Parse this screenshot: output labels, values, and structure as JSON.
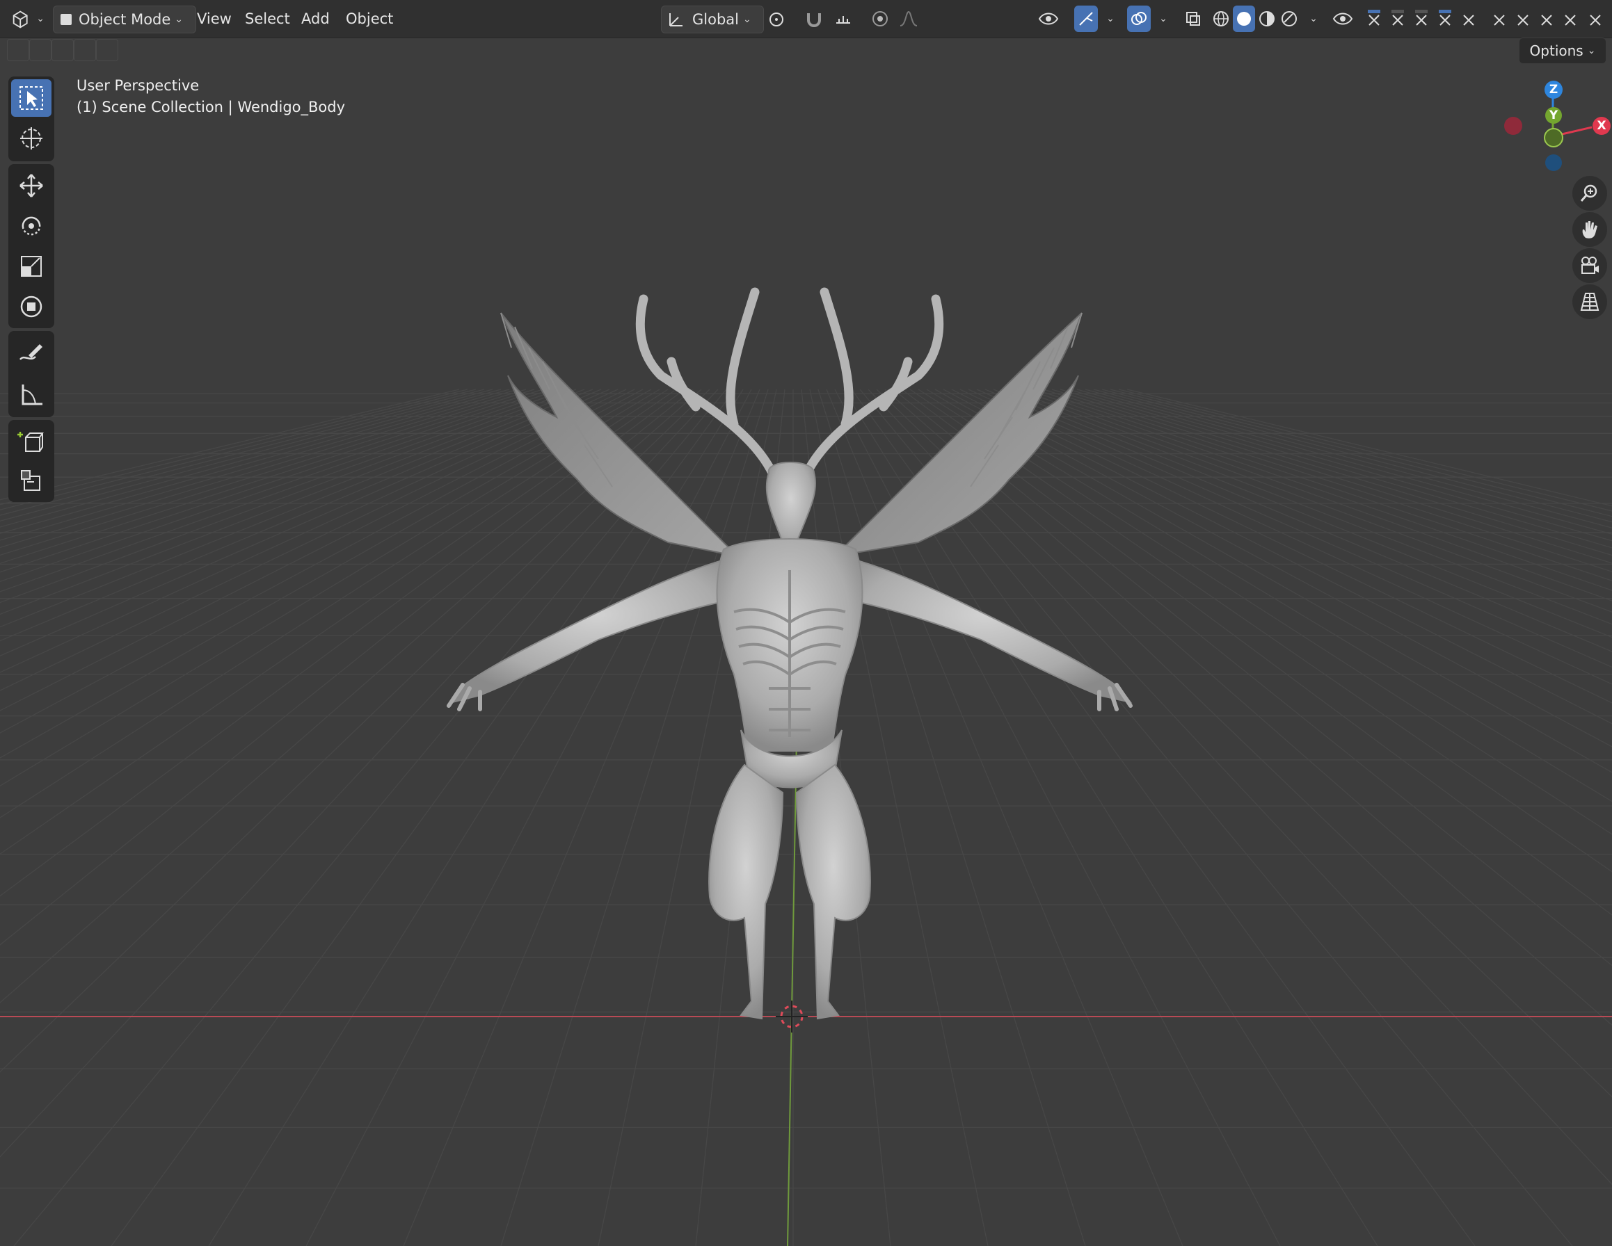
{
  "header": {
    "editor_type_icon": "view3d-icon",
    "mode_label": "Object Mode",
    "menus": [
      "View",
      "Select",
      "Add",
      "Object"
    ],
    "transform_orientation": "Global",
    "options_label": "Options"
  },
  "viewport": {
    "perspective_label": "User Perspective",
    "collection_label": "(1) Scene Collection | Wendigo_Body",
    "object_name": "Wendigo_Body"
  },
  "gizmo": {
    "z_label": "Z",
    "y_label": "Y",
    "x_label": "X"
  },
  "toolbar": {
    "tools": [
      "select-box-icon",
      "cursor-icon",
      "move-icon",
      "rotate-icon",
      "scale-icon",
      "transform-icon",
      "annotate-icon",
      "measure-icon",
      "add-cube-icon",
      "extrude-icon"
    ]
  },
  "colors": {
    "header_bg": "#303030",
    "viewport_bg": "#3d3d3d",
    "accent_blue": "#4772b3",
    "axis_x": "#e0394f",
    "axis_y": "#74a62f",
    "axis_z": "#2e86de",
    "model_gray": "#bdbdbd"
  }
}
